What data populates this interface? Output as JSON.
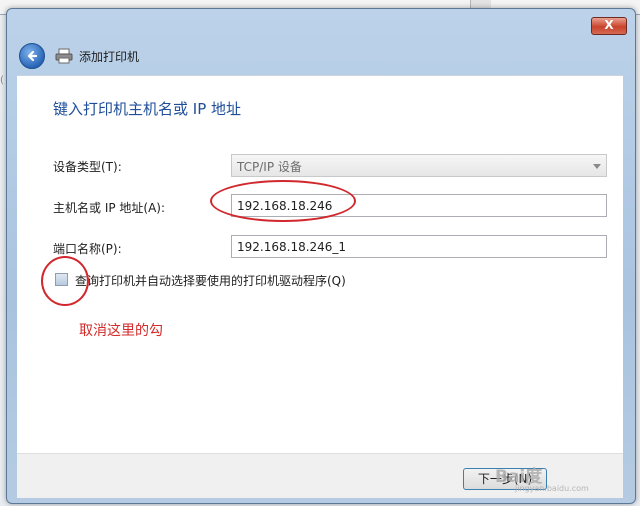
{
  "window": {
    "title": "添加打印机",
    "close_label": "X"
  },
  "page": {
    "heading": "键入打印机主机名或 IP 地址"
  },
  "form": {
    "device_type_label": "设备类型(T):",
    "device_type_value": "TCP/IP 设备",
    "hostname_label": "主机名或 IP 地址(A):",
    "hostname_value": "192.168.18.246",
    "port_name_label": "端口名称(P):",
    "port_name_value": "192.168.18.246_1",
    "query_checkbox_label": "查询打印机并自动选择要使用的打印机驱动程序(Q)",
    "query_checkbox_checked": false
  },
  "annotation": {
    "text": "取消这里的勾",
    "color": "#d32a2a"
  },
  "footer": {
    "next_label": "下一步(N)"
  },
  "watermark": {
    "text": "Bai度",
    "sub": "jingyan.baidu.com"
  },
  "icons": {
    "back": "back-arrow-icon",
    "printer": "printer-icon"
  }
}
